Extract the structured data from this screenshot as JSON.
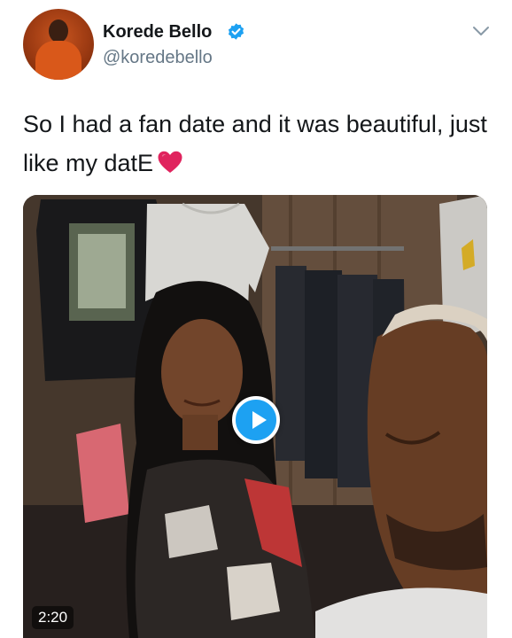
{
  "author": {
    "display_name": "Korede Bello",
    "handle": "@koredebello",
    "verified": true,
    "avatar": "profile-photo"
  },
  "tweet": {
    "text": "So I had a fan date and it was beautiful, just like my datE",
    "emoji": "red-heart"
  },
  "media": {
    "type": "video",
    "duration": "2:20",
    "thumbnail": "selfie-video-thumbnail"
  },
  "icons": {
    "verified": "verified-badge-icon",
    "menu": "chevron-down-icon",
    "play": "play-icon"
  },
  "colors": {
    "accent": "#1da1f2",
    "text": "#14171a",
    "secondary": "#657786",
    "heart": "#e0245e"
  }
}
